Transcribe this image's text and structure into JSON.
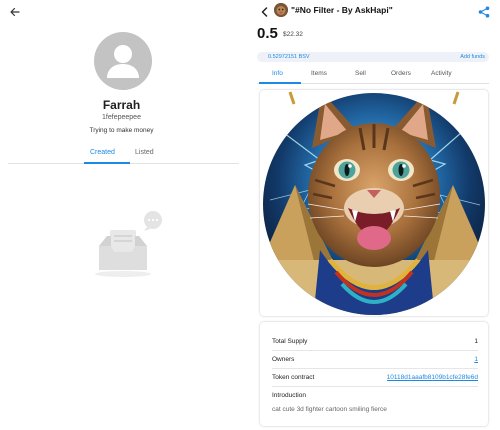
{
  "profile": {
    "name": "Farrah",
    "handle": "1fefepeepee",
    "bio": "Trying to make money",
    "tabs": [
      {
        "label": "Created",
        "active": true
      },
      {
        "label": "Listed",
        "active": false
      }
    ]
  },
  "token": {
    "title": "\"#No Filter - By AskHapi\"",
    "price": "0.5",
    "price_usd": "$22.32",
    "balance": "0.52972151 BSV",
    "add_funds_label": "Add funds",
    "tabs": [
      {
        "label": "Info",
        "active": true
      },
      {
        "label": "Items",
        "active": false
      },
      {
        "label": "Sell",
        "active": false
      },
      {
        "label": "Orders",
        "active": false
      },
      {
        "label": "Activity",
        "active": false
      }
    ],
    "details": {
      "total_supply_label": "Total Supply",
      "total_supply": "1",
      "owners_label": "Owners",
      "owners": "1",
      "contract_label": "Token contract",
      "contract": "10118d1aaafb8109b1cfe28fe6d",
      "intro_label": "Introduction",
      "intro_text": "cat cute 3d fighter cartoon smiling fierce"
    }
  },
  "icons": {
    "back": "arrow-back-icon",
    "share": "share-icon",
    "empty": "empty-inbox-illustration"
  },
  "colors": {
    "accent": "#1e88e5",
    "balance_bg": "#eef2f8"
  }
}
